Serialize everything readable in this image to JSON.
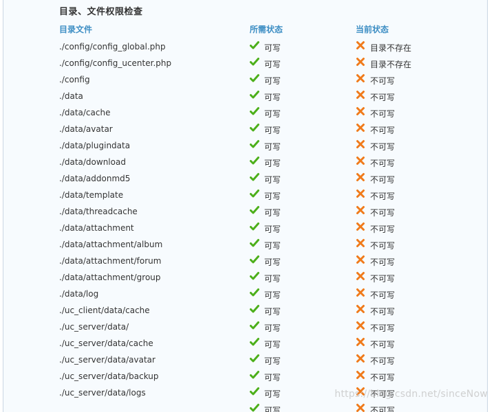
{
  "section_title": "目录、文件权限检查",
  "headers": {
    "file": "目录文件",
    "required": "所需状态",
    "current": "当前状态"
  },
  "colors": {
    "header_blue": "#3d8ec4",
    "check_green": "#4caf1a",
    "cross_orange": "#f07a1a"
  },
  "rows": [
    {
      "path": "./config/config_global.php",
      "required": "可写",
      "current": "目录不存在"
    },
    {
      "path": "./config/config_ucenter.php",
      "required": "可写",
      "current": "目录不存在"
    },
    {
      "path": "./config",
      "required": "可写",
      "current": "不可写"
    },
    {
      "path": "./data",
      "required": "可写",
      "current": "不可写"
    },
    {
      "path": "./data/cache",
      "required": "可写",
      "current": "不可写"
    },
    {
      "path": "./data/avatar",
      "required": "可写",
      "current": "不可写"
    },
    {
      "path": "./data/plugindata",
      "required": "可写",
      "current": "不可写"
    },
    {
      "path": "./data/download",
      "required": "可写",
      "current": "不可写"
    },
    {
      "path": "./data/addonmd5",
      "required": "可写",
      "current": "不可写"
    },
    {
      "path": "./data/template",
      "required": "可写",
      "current": "不可写"
    },
    {
      "path": "./data/threadcache",
      "required": "可写",
      "current": "不可写"
    },
    {
      "path": "./data/attachment",
      "required": "可写",
      "current": "不可写"
    },
    {
      "path": "./data/attachment/album",
      "required": "可写",
      "current": "不可写"
    },
    {
      "path": "./data/attachment/forum",
      "required": "可写",
      "current": "不可写"
    },
    {
      "path": "./data/attachment/group",
      "required": "可写",
      "current": "不可写"
    },
    {
      "path": "./data/log",
      "required": "可写",
      "current": "不可写"
    },
    {
      "path": "./uc_client/data/cache",
      "required": "可写",
      "current": "不可写"
    },
    {
      "path": "./uc_server/data/",
      "required": "可写",
      "current": "不可写"
    },
    {
      "path": "./uc_server/data/cache",
      "required": "可写",
      "current": "不可写"
    },
    {
      "path": "./uc_server/data/avatar",
      "required": "可写",
      "current": "不可写"
    },
    {
      "path": "./uc_server/data/backup",
      "required": "可写",
      "current": "不可写"
    },
    {
      "path": "./uc_server/data/logs",
      "required": "可写",
      "current": "不可写"
    },
    {
      "path": "",
      "required": "可写",
      "current": "不可写"
    }
  ],
  "icons": {
    "required": "check-icon",
    "current": "cross-icon"
  },
  "watermark": "https://blog.csdn.net/sinceNow"
}
